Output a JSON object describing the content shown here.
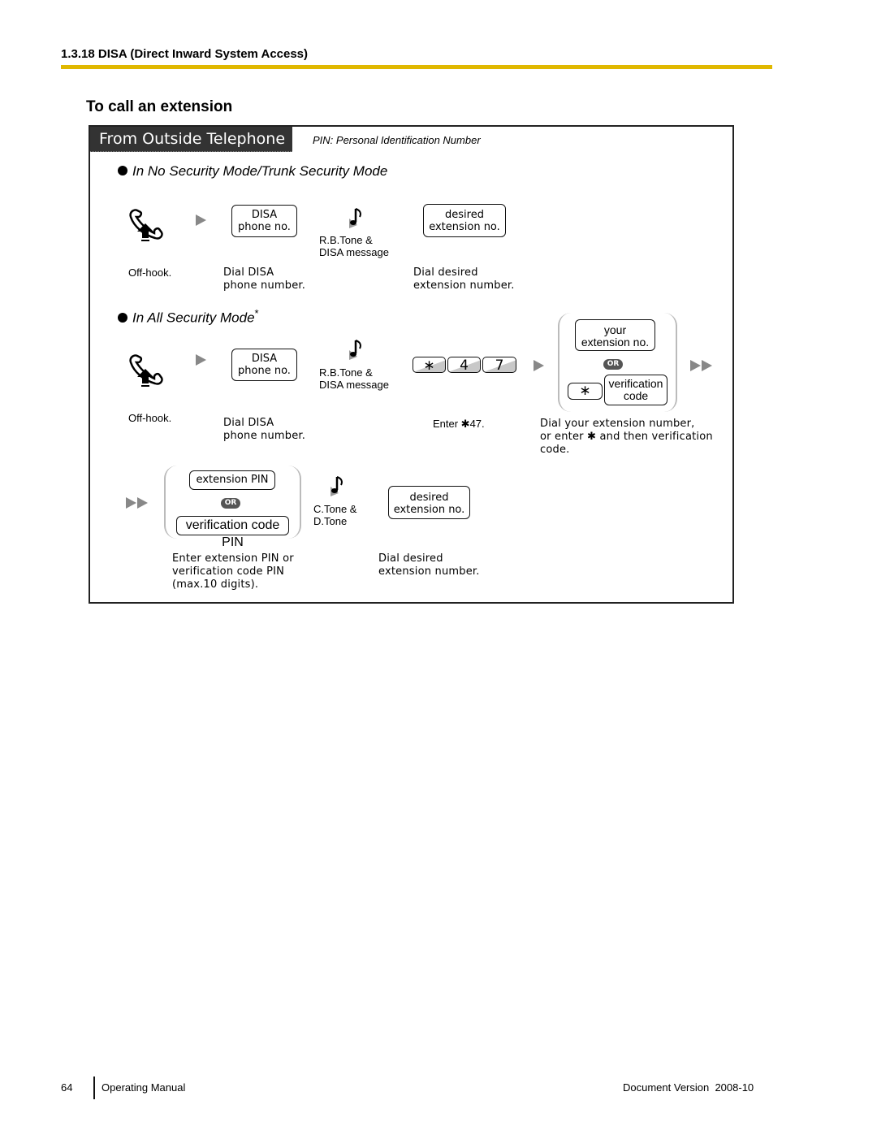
{
  "header": {
    "section_title": "1.3.18 DISA (Direct Inward System Access)",
    "rule_color": "#e0b800"
  },
  "subtitle": "To call an extension",
  "panel": {
    "tab_label": "From Outside Telephone",
    "pin_note": "PIN: Personal Identification Number",
    "no_security": {
      "heading": "In No Security Mode/Trunk Security Mode",
      "steps": {
        "offhook_icon": "handset-offhook-icon",
        "offhook_caption": "Off-hook.",
        "disa_key_line1": "DISA",
        "disa_key_line2": "phone no.",
        "disa_caption_line1": "Dial DISA",
        "disa_caption_line2": "phone number.",
        "tone_icon": "music-note-icon",
        "tone_line1": "R.B.Tone &",
        "tone_line2": "DISA message",
        "ext_key_line1": "desired",
        "ext_key_line2": "extension no.",
        "ext_caption_line1": "Dial desired",
        "ext_caption_line2": "extension number."
      }
    },
    "all_security": {
      "heading": "In All Security Mode",
      "heading_mark": "*",
      "steps": {
        "offhook_caption": "Off-hook.",
        "disa_key_line1": "DISA",
        "disa_key_line2": "phone no.",
        "disa_caption_line1": "Dial DISA",
        "disa_caption_line2": "phone number.",
        "tone_line1": "R.B.Tone &",
        "tone_line2": "DISA message",
        "dial_keys": [
          "∗",
          "4",
          "7"
        ],
        "enter_caption": "Enter ✱47.",
        "your_ext_line1": "your",
        "your_ext_line2": "extension no.",
        "or_label": "OR",
        "star_key": "∗",
        "verif_line1": "verification",
        "verif_line2": "code",
        "choice_caption_line1": "Dial your extension number,",
        "choice_caption_line2": "or enter ✱ and then verification",
        "choice_caption_line3": "code.",
        "ext_pin_key": "extension PIN",
        "or_label2": "OR",
        "verif_pin_key": "verification code PIN",
        "pin_caption_line1": "Enter extension PIN or",
        "pin_caption_line2": "verification code PIN",
        "pin_caption_line3": "(max.10 digits).",
        "tone2_line1": "C.Tone &",
        "tone2_line2": "D.Tone",
        "ext_key_line1": "desired",
        "ext_key_line2": "extension no.",
        "ext_caption_line1": "Dial desired",
        "ext_caption_line2": "extension number."
      }
    }
  },
  "footer": {
    "page_number": "64",
    "manual": "Operating Manual",
    "version": "Document Version  2008-10"
  }
}
